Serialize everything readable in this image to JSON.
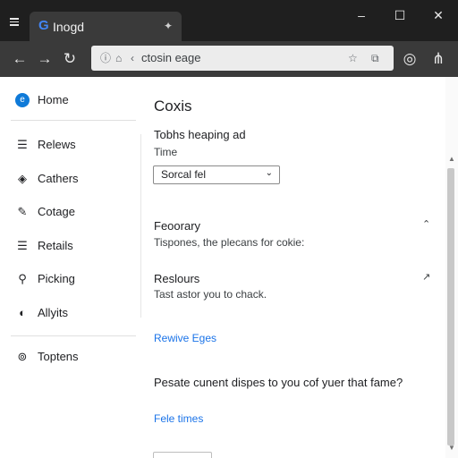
{
  "colors": {
    "accent": "#1a73e8",
    "tabbar_bg": "#1f1f1f",
    "toolbar_bg": "#3a3a3a",
    "home_icon": "#0f7ad8"
  },
  "tab": {
    "favicon": "G",
    "title": "Inogd",
    "right_icon": "pin-icon"
  },
  "window_controls": {
    "minimize": "–",
    "maximize": "☐",
    "close": "✕"
  },
  "toolbar": {
    "back_icon": "back-arrow-icon",
    "forward_icon": "forward-arrow-icon",
    "reload_icon": "reload-icon",
    "address": "ctosin eage",
    "address_prefix": "‹",
    "extensions": [
      "star-icon",
      "extension-icon",
      "profile-icon",
      "settings-icon"
    ]
  },
  "sidebar": {
    "items": [
      {
        "label": "Home",
        "icon": "home-icon"
      },
      {
        "label": "Relews",
        "icon": "list-icon"
      },
      {
        "label": "Cathers",
        "icon": "shield-icon"
      },
      {
        "label": "Cotage",
        "icon": "pencil-icon"
      },
      {
        "label": "Retails",
        "icon": "list-icon"
      },
      {
        "label": "Picking",
        "icon": "search-icon"
      },
      {
        "label": "Allyits",
        "icon": "contrast-icon"
      },
      {
        "label": "Toptens",
        "icon": "location-icon"
      }
    ]
  },
  "main": {
    "title": "Coxis",
    "section1": {
      "heading": "Tobhs heaping ad",
      "label": "Time",
      "select_value": "Sorcal fel"
    },
    "section2": {
      "heading": "Feoorary",
      "description": "Tispones, the plecans for cokie:"
    },
    "section3": {
      "heading": "Reslours",
      "description": "Tast astor you to chack."
    },
    "link1": "Rewive Eges",
    "question": "Pesate cunent dispes to you cof yuer that fame?",
    "link2": "Fele times"
  }
}
